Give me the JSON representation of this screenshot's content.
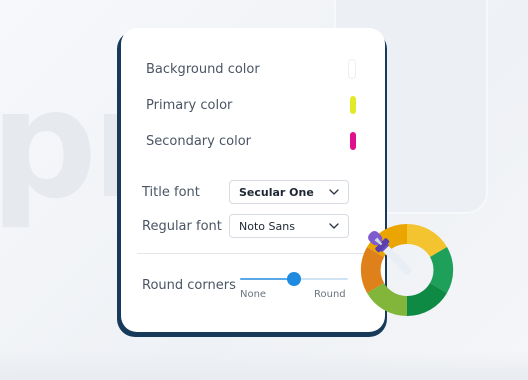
{
  "colors": {
    "background_label": "Background color",
    "primary_label": "Primary color",
    "secondary_label": "Secondary color",
    "background_value": "#ffffff",
    "primary_value": "#e2ea2a",
    "secondary_value": "#e0108c"
  },
  "fonts": {
    "title_label": "Title font",
    "title_value": "Secular One",
    "regular_label": "Regular font",
    "regular_value": "Noto Sans"
  },
  "corners": {
    "label": "Round corners",
    "min_label": "None",
    "max_label": "Round",
    "value": 0.5
  },
  "icons": {
    "select_chevron": "chevron-down-icon",
    "color_picker": "eyedropper-color-wheel-icon"
  }
}
